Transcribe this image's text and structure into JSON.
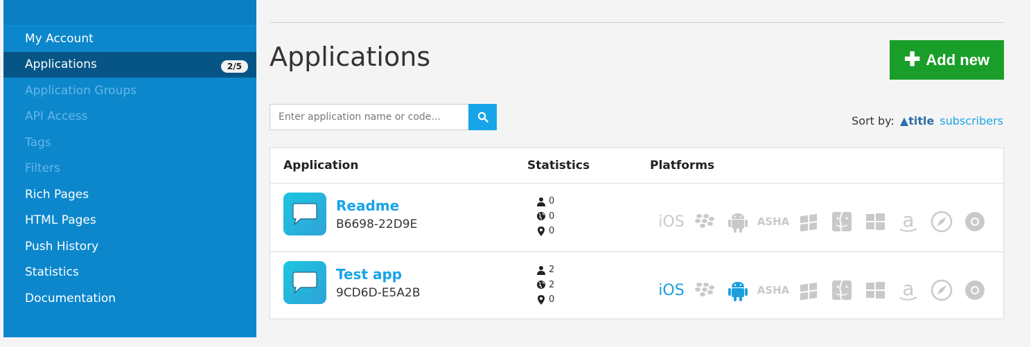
{
  "sidebar": {
    "items": [
      {
        "label": "My Account"
      },
      {
        "label": "Applications",
        "badge": "2/5"
      },
      {
        "label": "Application Groups"
      },
      {
        "label": "API Access"
      },
      {
        "label": "Tags"
      },
      {
        "label": "Filters"
      },
      {
        "label": "Rich Pages"
      },
      {
        "label": "HTML Pages"
      },
      {
        "label": "Push History"
      },
      {
        "label": "Statistics"
      },
      {
        "label": "Documentation"
      }
    ]
  },
  "header": {
    "title": "Applications",
    "add_button_label": "Add new"
  },
  "search": {
    "placeholder": "Enter application name or code..."
  },
  "sort": {
    "label": "Sort by:",
    "title_option": "▲title",
    "subscribers_option": "subscribers"
  },
  "table": {
    "columns": [
      "Application",
      "Statistics",
      "Platforms"
    ],
    "rows": [
      {
        "name": "Readme",
        "code": "B6698-22D9E",
        "stats": [
          "0",
          "0",
          "0"
        ]
      },
      {
        "name": "Test app",
        "code": "9CD6D-E5A2B",
        "stats": [
          "2",
          "2",
          "0"
        ]
      }
    ],
    "platform_labels": {
      "ios": "iOS",
      "asha": "ASHA"
    }
  },
  "colors": {
    "sidebar": "#0c87cc",
    "sidebar_active": "#075586",
    "accent": "#18a4e8",
    "add_button": "#1a9e2a"
  }
}
